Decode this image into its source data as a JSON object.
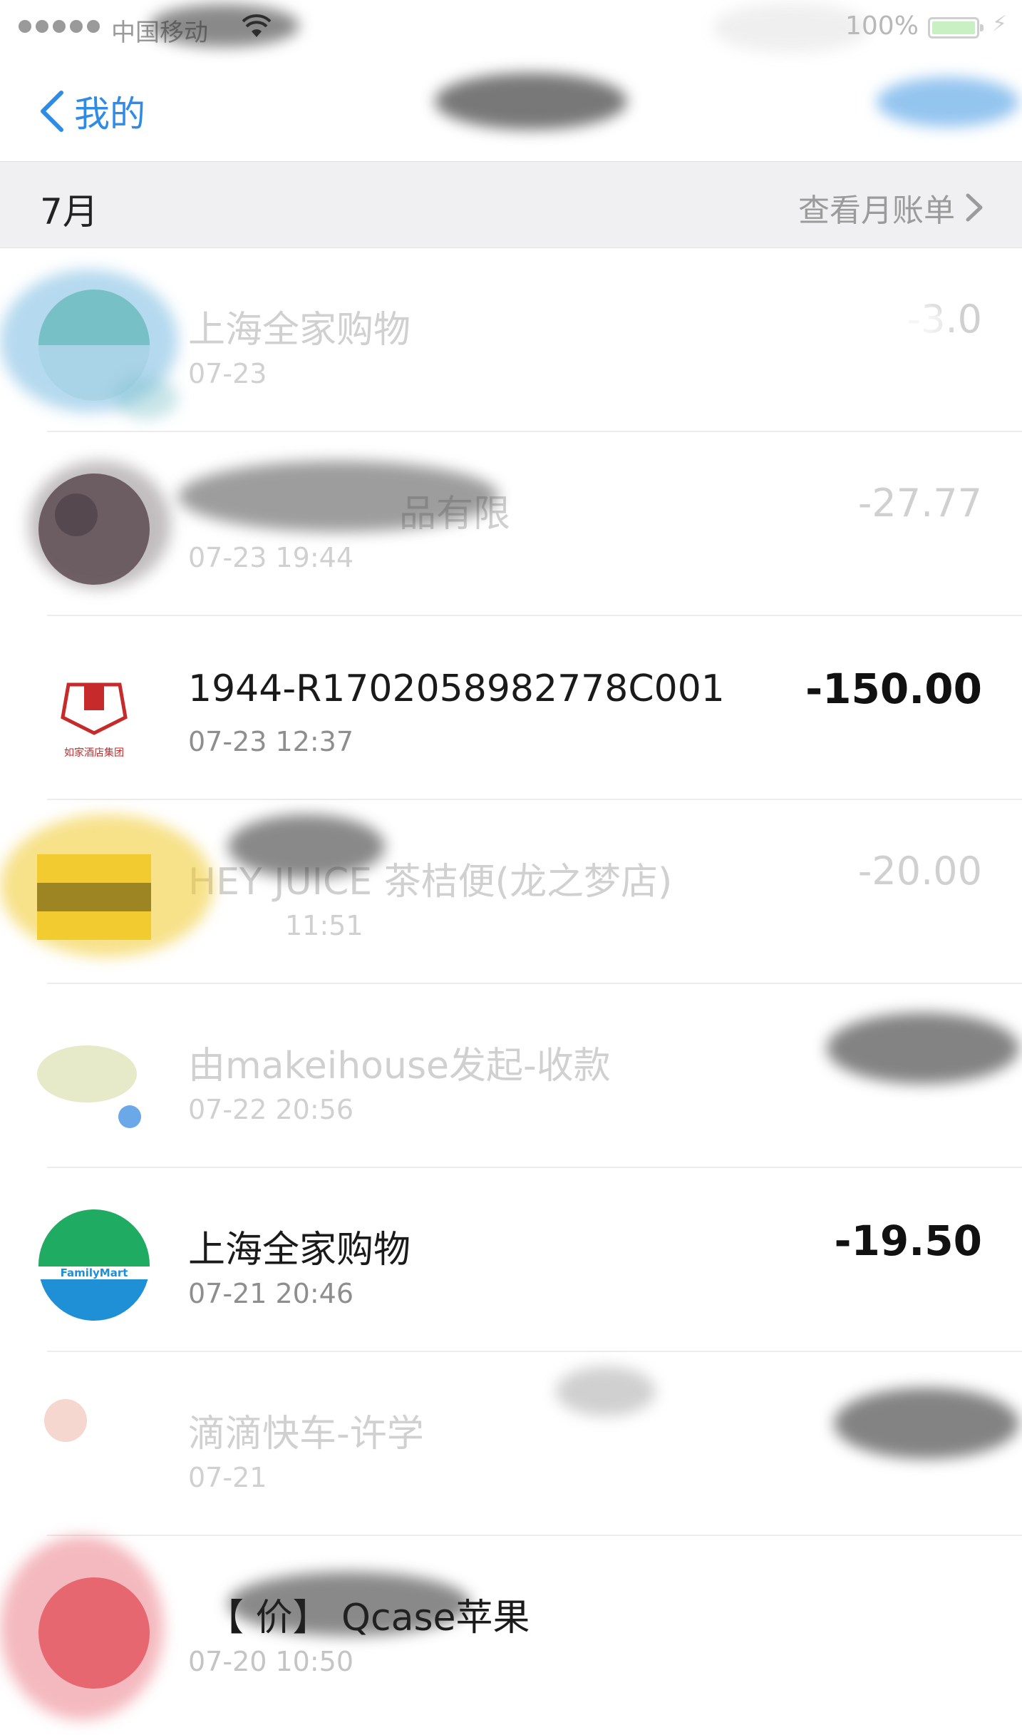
{
  "status_bar": {
    "carrier": "中国移动",
    "battery": "100%"
  },
  "nav": {
    "back_label": "我的"
  },
  "month_header": {
    "month": "7月",
    "bill_link": "查看月账单"
  },
  "transactions": [
    {
      "title": "上海全家购物",
      "time": "07-23",
      "amount": "-3.0",
      "icon": "familymart-logo",
      "obscured": true
    },
    {
      "title": "品有限",
      "time": "07-23 19:44",
      "amount": "-27.77",
      "icon": "merchant-avatar",
      "obscured": true
    },
    {
      "title": "1944-R1702058982778C001",
      "time": "07-23  12:37",
      "amount": "-150.00",
      "icon": "rujia-hotel-logo",
      "icon_text": "如家酒店集团",
      "obscured": false
    },
    {
      "title": "HEY JUICE 茶桔便(龙之梦店)",
      "time": "11:51",
      "amount": "-20.00",
      "icon": "hey-juice-logo",
      "obscured": true
    },
    {
      "title": "由makeihouse发起-收款",
      "time": "07-22 20:56",
      "amount": "",
      "icon": "user-avatar",
      "obscured": true
    },
    {
      "title": "上海全家购物",
      "time": "07-21  20:46",
      "amount": "-19.50",
      "icon": "familymart-logo",
      "obscured": false
    },
    {
      "title": "滴滴快车-许学",
      "time": "07-21",
      "amount": "",
      "icon": "didi-logo",
      "obscured": true
    },
    {
      "title": "【 价】 Qcase苹果",
      "time": "07-20 10:50",
      "amount": "",
      "icon": "shop-avatar",
      "obscured": true
    }
  ]
}
